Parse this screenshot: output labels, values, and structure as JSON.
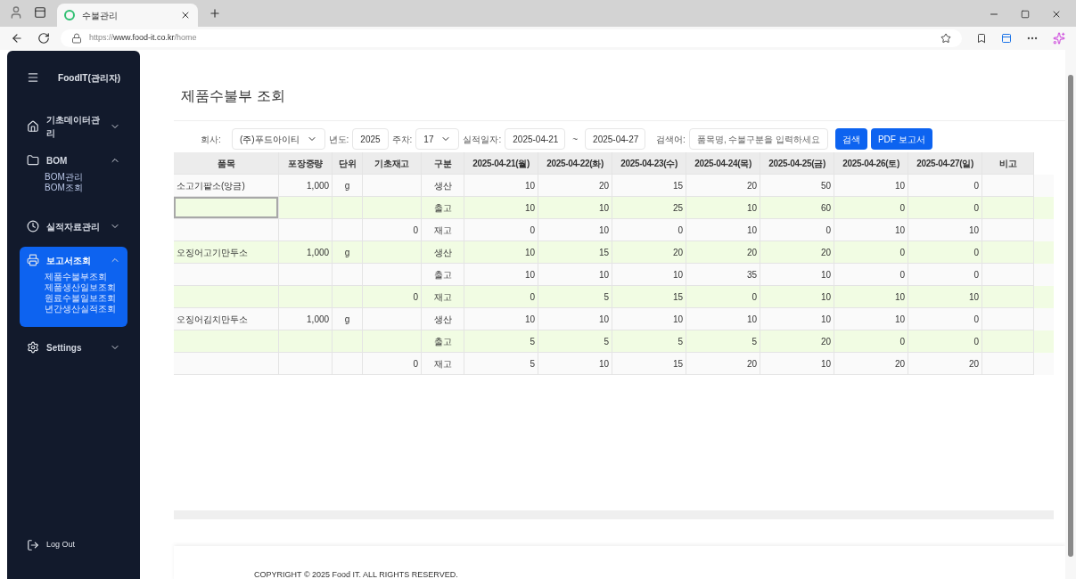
{
  "browser": {
    "tab_title": "수불관리",
    "url_scheme": "https://",
    "url_host": "www.food-it.co.kr",
    "url_path": "/home"
  },
  "sidebar": {
    "brand": "FoodIT(관리자)",
    "items": [
      {
        "label": "기초데이터관리",
        "expanded": false,
        "selected": false
      },
      {
        "label": "BOM",
        "expanded": true,
        "selected": false,
        "children": [
          {
            "label": "BOM관리"
          },
          {
            "label": "BOM조회"
          }
        ]
      },
      {
        "label": "실적자료관리",
        "expanded": false,
        "selected": false
      },
      {
        "label": "보고서조회",
        "expanded": true,
        "selected": true,
        "children": [
          {
            "label": "제품수불부조회"
          },
          {
            "label": "제품생산일보조회"
          },
          {
            "label": "원료수불일보조회"
          },
          {
            "label": "년간생산실적조회"
          }
        ]
      },
      {
        "label": "Settings",
        "expanded": false,
        "selected": false
      }
    ],
    "logout": "Log Out"
  },
  "page_title": "제품수불부 조회",
  "filters": {
    "company_label": "회사:",
    "company": "(주)푸드아이티",
    "year_label": "년도:",
    "year": "2025",
    "week_label": "주차:",
    "week": "17",
    "date_label": "실적일자:",
    "date_from": "2025-04-21",
    "date_sep": "~",
    "date_to": "2025-04-27",
    "search_label": "검색어:",
    "search_placeholder": "품목명, 수불구분을 입력하세요",
    "search_button": "검색",
    "pdf_button": "PDF 보고서"
  },
  "table": {
    "columns": [
      "품목",
      "포장중량",
      "단위",
      "기초재고",
      "구분",
      "2025-04-21(월)",
      "2025-04-22(화)",
      "2025-04-23(수)",
      "2025-04-24(목)",
      "2025-04-25(금)",
      "2025-04-26(토)",
      "2025-04-27(일)",
      "비고"
    ],
    "rows": [
      {
        "item": "소고기팥소(앙금)",
        "weight": "1,000",
        "unit": "g",
        "opening": "",
        "category": "생산",
        "values": [
          "10",
          "20",
          "15",
          "20",
          "50",
          "10",
          "0"
        ],
        "focused": false
      },
      {
        "item": "",
        "weight": "",
        "unit": "",
        "opening": "",
        "category": "출고",
        "values": [
          "10",
          "10",
          "25",
          "10",
          "60",
          "0",
          "0"
        ],
        "focused": true
      },
      {
        "item": "",
        "weight": "",
        "unit": "",
        "opening": "0",
        "category": "재고",
        "values": [
          "0",
          "10",
          "0",
          "10",
          "0",
          "10",
          "10"
        ],
        "focused": false
      },
      {
        "item": "오징어고기만두소",
        "weight": "1,000",
        "unit": "g",
        "opening": "",
        "category": "생산",
        "values": [
          "10",
          "15",
          "20",
          "20",
          "20",
          "0",
          "0"
        ],
        "focused": false
      },
      {
        "item": "",
        "weight": "",
        "unit": "",
        "opening": "",
        "category": "출고",
        "values": [
          "10",
          "10",
          "10",
          "35",
          "10",
          "0",
          "0"
        ],
        "focused": false
      },
      {
        "item": "",
        "weight": "",
        "unit": "",
        "opening": "0",
        "category": "재고",
        "values": [
          "0",
          "5",
          "15",
          "0",
          "10",
          "10",
          "10"
        ],
        "focused": false
      },
      {
        "item": "오징어김치만두소",
        "weight": "1,000",
        "unit": "g",
        "opening": "",
        "category": "생산",
        "values": [
          "10",
          "10",
          "10",
          "10",
          "10",
          "10",
          "0"
        ],
        "focused": false
      },
      {
        "item": "",
        "weight": "",
        "unit": "",
        "opening": "",
        "category": "출고",
        "values": [
          "5",
          "5",
          "5",
          "5",
          "20",
          "0",
          "0"
        ],
        "focused": false
      },
      {
        "item": "",
        "weight": "",
        "unit": "",
        "opening": "0",
        "category": "재고",
        "values": [
          "5",
          "10",
          "15",
          "20",
          "10",
          "20",
          "20"
        ],
        "focused": false
      }
    ]
  },
  "footer": "COPYRIGHT © 2025 Food IT. ALL RIGHTS RESERVED."
}
